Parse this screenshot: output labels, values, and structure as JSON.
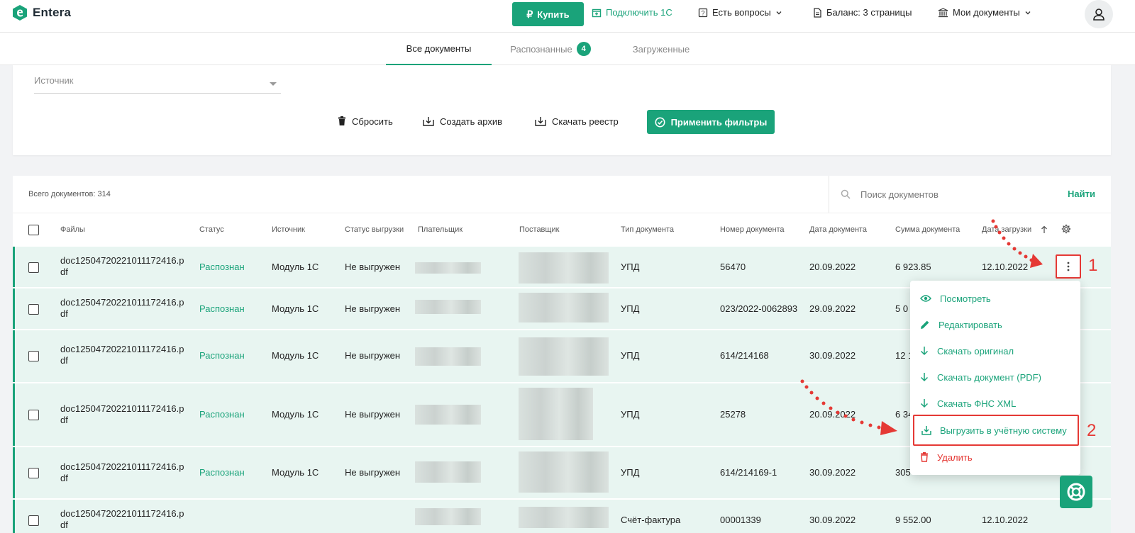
{
  "header": {
    "app_name": "Entera",
    "buy_label": "Купить",
    "connect_label": "Подключить 1С",
    "questions_label": "Есть вопросы",
    "balance_label": "Баланс: 3 страницы",
    "my_docs_label": "Мои документы"
  },
  "tabs": [
    {
      "label": "Все документы",
      "active": true
    },
    {
      "label": "Распознанные",
      "badge": "4"
    },
    {
      "label": "Загруженные"
    }
  ],
  "filters": {
    "source_placeholder": "Источник",
    "reset_label": "Сбросить",
    "archive_label": "Создать архив",
    "registry_label": "Скачать реестр",
    "apply_label": "Применить фильтры"
  },
  "table": {
    "total_label": "Всего документов: 314",
    "search_placeholder": "Поиск документов",
    "search_button": "Найти",
    "columns": [
      "Файлы",
      "Статус",
      "Источник",
      "Статус выгрузки",
      "Плательщик",
      "Поставщик",
      "Тип документа",
      "Номер документа",
      "Дата документа",
      "Сумма документа",
      "Дата загрузки"
    ],
    "rows": [
      {
        "file": "doc12504720221011172416.pdf",
        "status": "Распознан",
        "source": "Модуль 1С",
        "export": "Не выгружен",
        "type": "УПД",
        "number": "56470",
        "date": "20.09.2022",
        "sum": "6 923.85",
        "uploaded": "12.10.2022"
      },
      {
        "file": "doc12504720221011172416.pdf",
        "status": "Распознан",
        "source": "Модуль 1С",
        "export": "Не выгружен",
        "type": "УПД",
        "number": "023/2022-0062893",
        "date": "29.09.2022",
        "sum": "5 0",
        "uploaded": ""
      },
      {
        "file": "doc12504720221011172416.pdf",
        "status": "Распознан",
        "source": "Модуль 1С",
        "export": "Не выгружен",
        "type": "УПД",
        "number": "614/214168",
        "date": "30.09.2022",
        "sum": "12 1",
        "uploaded": ""
      },
      {
        "file": "doc12504720221011172416.pdf",
        "status": "Распознан",
        "source": "Модуль 1С",
        "export": "Не выгружен",
        "type": "УПД",
        "number": "25278",
        "date": "20.09.2022",
        "sum": "6 34",
        "uploaded": ""
      },
      {
        "file": "doc12504720221011172416.pdf",
        "status": "Распознан",
        "source": "Модуль 1С",
        "export": "Не выгружен",
        "type": "УПД",
        "number": "614/214169-1",
        "date": "30.09.2022",
        "sum": "305",
        "uploaded": ""
      },
      {
        "file": "doc12504720221011172416.pdf",
        "status": "",
        "source": "",
        "export": "",
        "type": "Счёт-фактура",
        "number": "00001339",
        "date": "30.09.2022",
        "sum": "9 552.00",
        "uploaded": "12.10.2022"
      }
    ]
  },
  "menu": {
    "items": [
      {
        "label": "Посмотреть",
        "icon": "eye-icon"
      },
      {
        "label": "Редактировать",
        "icon": "pencil-icon"
      },
      {
        "label": "Скачать оригинал",
        "icon": "arrow-down-icon"
      },
      {
        "label": "Скачать документ (PDF)",
        "icon": "arrow-down-icon"
      },
      {
        "label": "Скачать ФНС XML",
        "icon": "arrow-down-icon"
      },
      {
        "label": "Выгрузить в учётную систему",
        "icon": "download-tray-icon",
        "highlighted": true
      },
      {
        "label": "Удалить",
        "icon": "trash-icon",
        "danger": true
      }
    ]
  },
  "annotations": {
    "marker_1": "1",
    "marker_2": "2"
  },
  "colors": {
    "accent": "#1aa37a",
    "highlight": "#e53935",
    "row_bg": "#e8f5f1"
  }
}
